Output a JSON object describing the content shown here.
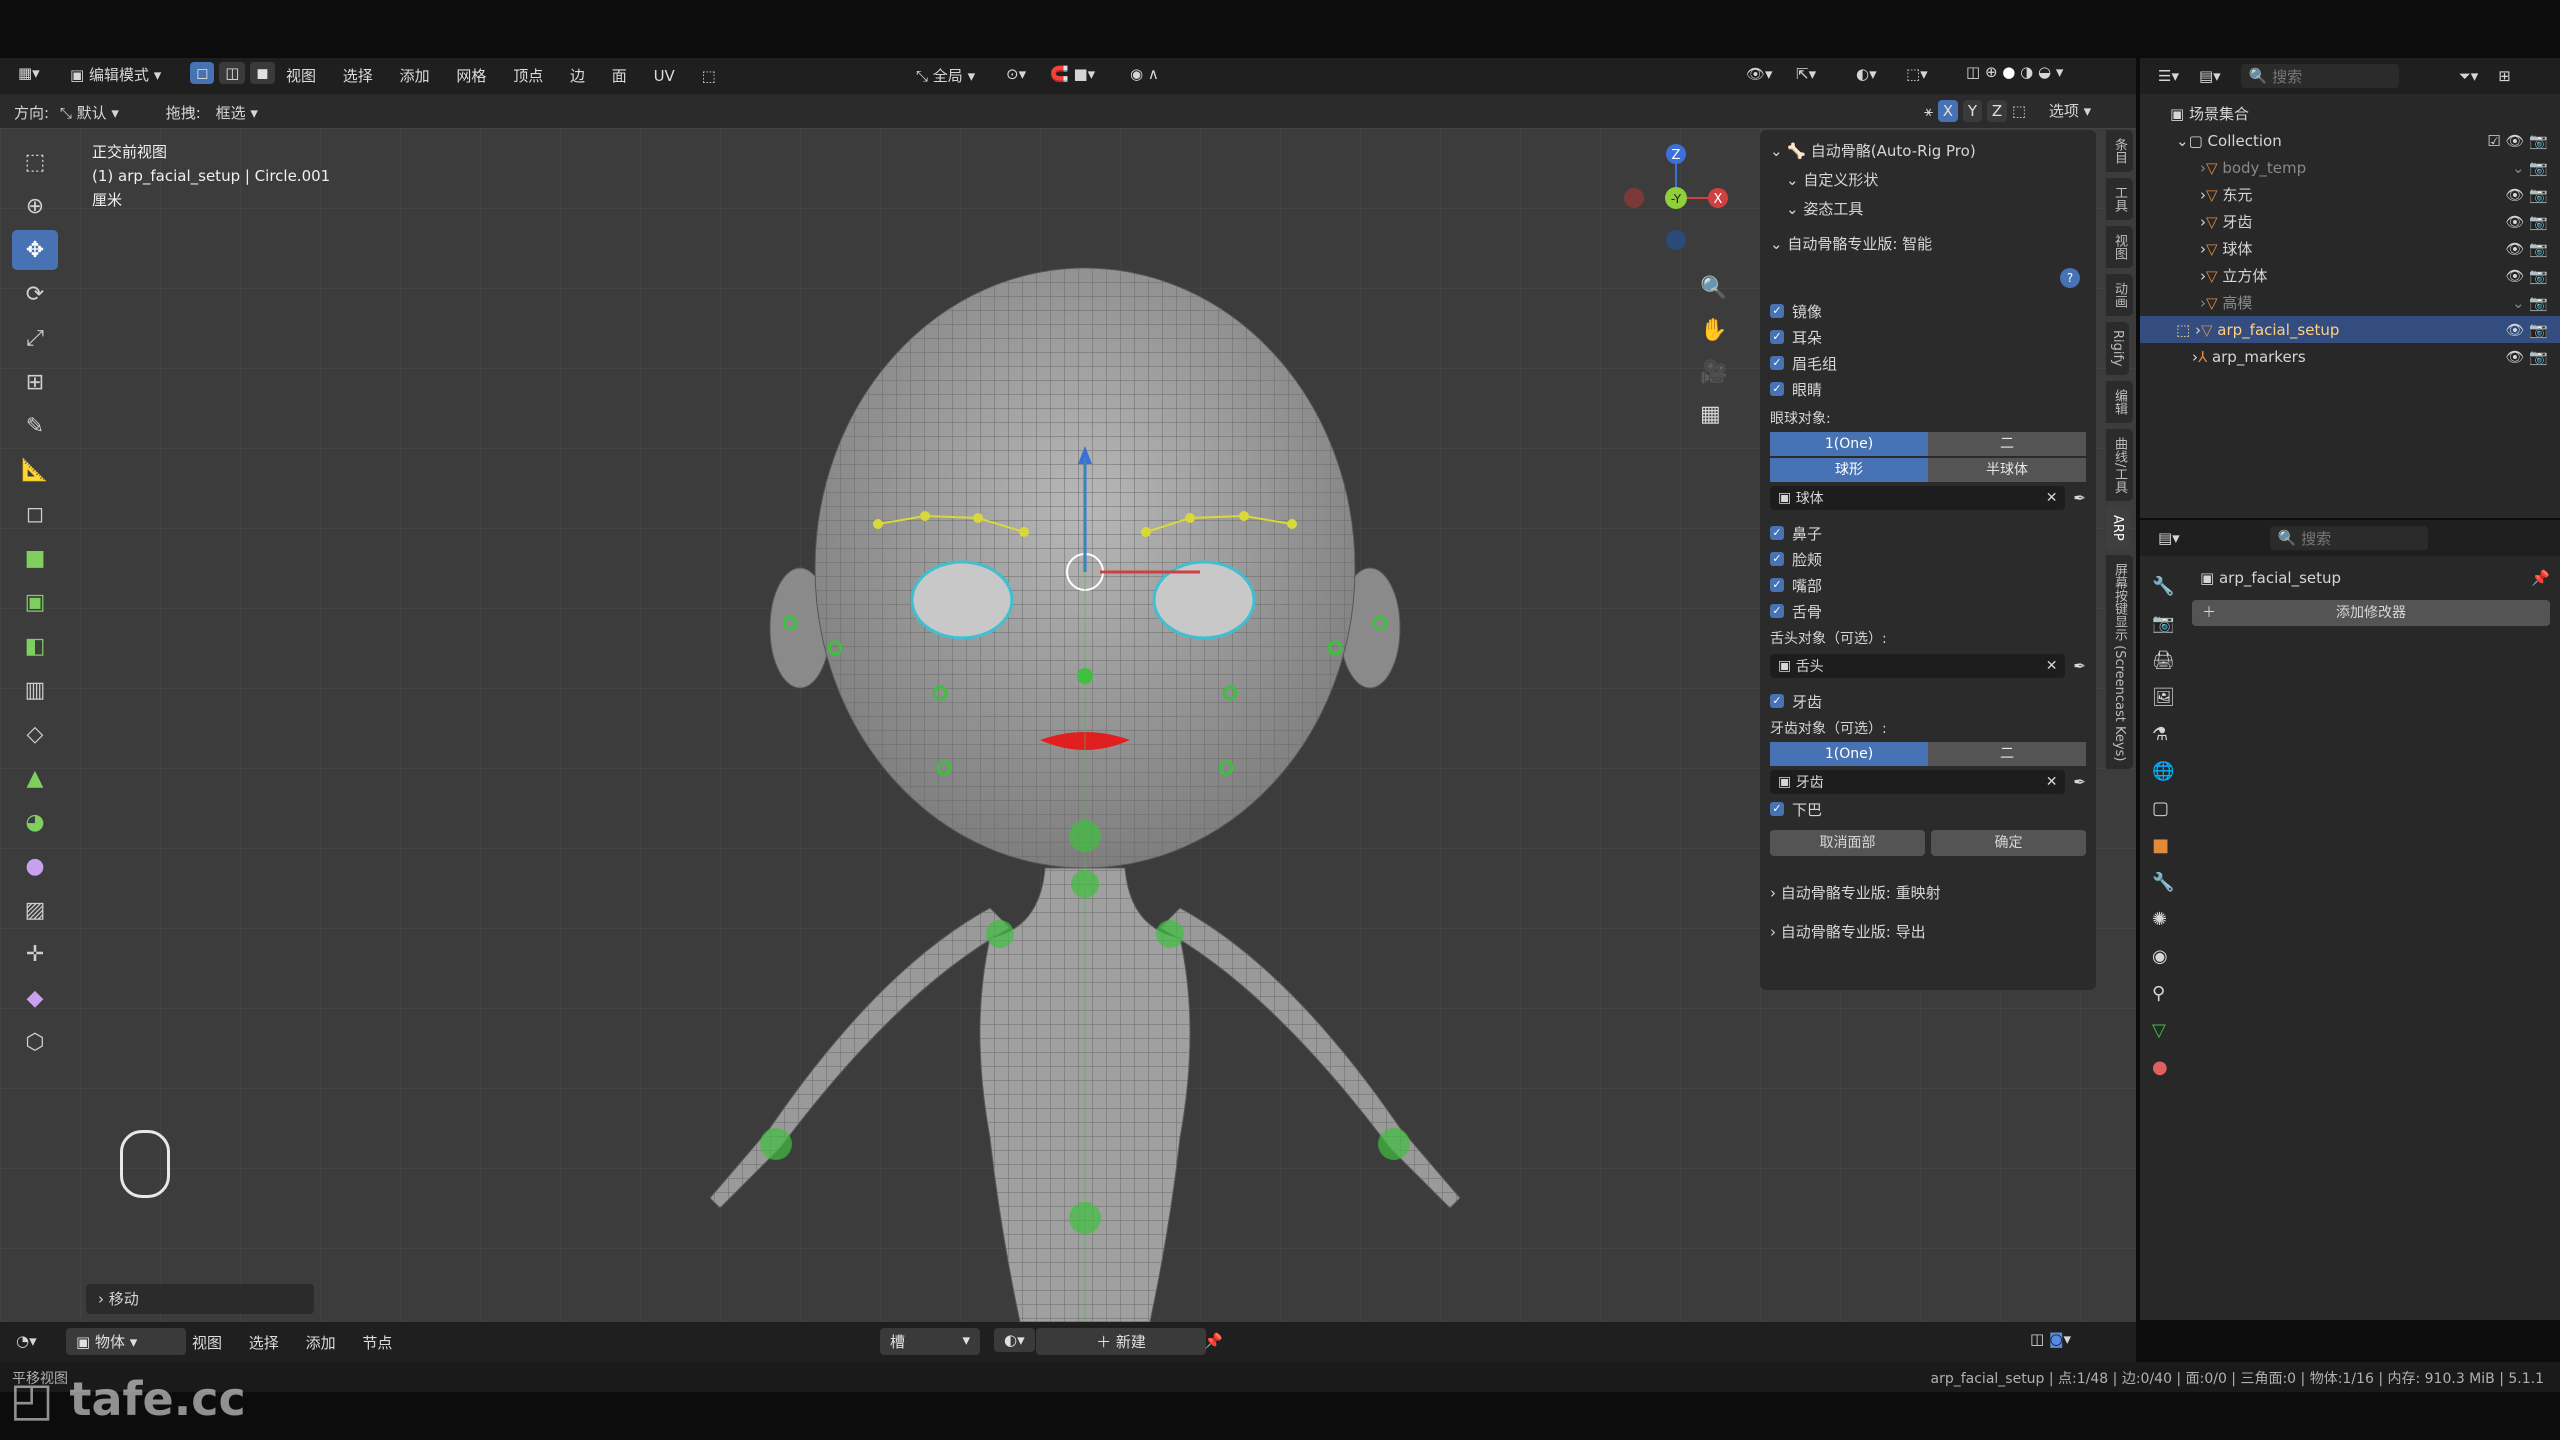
{
  "top_header": {
    "mode": "编辑模式",
    "menus": [
      "视图",
      "选择",
      "添加",
      "网格",
      "顶点",
      "边",
      "面",
      "UV"
    ],
    "transform_orientation": "全局"
  },
  "second_header": {
    "orientation_label": "方向:",
    "orientation_value": "默认",
    "drag_label": "拖拽:",
    "drag_value": "框选",
    "axis_x": "X",
    "axis_y": "Y",
    "axis_z": "Z",
    "options": "选项"
  },
  "viewport_info": {
    "view_name": "正交前视图",
    "object_line": "(1) arp_facial_setup | Circle.001",
    "units": "厘米"
  },
  "gizmo": {
    "z": "Z",
    "y": "-Y",
    "x": "X"
  },
  "npanel": {
    "header_title": "自动骨骼(Auto-Rig Pro)",
    "sub1": "自定义形状",
    "sub2": "姿态工具",
    "smart_title": "自动骨骼专业版: 智能",
    "checks": [
      "镜像",
      "耳朵",
      "眉毛组",
      "眼睛"
    ],
    "eye_object_label": "眼球对象:",
    "eye_seg1": [
      "1(One)",
      "二"
    ],
    "eye_seg2": [
      "球形",
      "半球体"
    ],
    "eye_field": "球体",
    "checks2": [
      "鼻子",
      "脸颊",
      "嘴部",
      "舌骨"
    ],
    "tongue_label": "舌头对象（可选）:",
    "tongue_field": "舌头",
    "teeth_check": "牙齿",
    "teeth_label": "牙齿对象（可选）:",
    "teeth_seg": [
      "1(One)",
      "二"
    ],
    "teeth_field": "牙齿",
    "jaw_check": "下巴",
    "cancel_face": "取消面部",
    "confirm": "确定",
    "remap_title": "自动骨骼专业版: 重映射",
    "export_title": "自动骨骼专业版: 导出"
  },
  "side_tabs": [
    "条目",
    "工具",
    "视图",
    "动画",
    "Rigify",
    "编辑",
    "曲线/工具",
    "ARP",
    "屏幕按键显示 (Screencast Keys)"
  ],
  "outliner": {
    "search_placeholder": "搜索",
    "scene_collection": "场景集合",
    "collection": "Collection",
    "items": [
      "body_temp",
      "东元",
      "牙齿",
      "球体",
      "立方体",
      "高模",
      "arp_facial_setup",
      "arp_markers"
    ]
  },
  "properties": {
    "search_placeholder": "搜索",
    "object_name": "arp_facial_setup",
    "add_modifier": "添加修改器"
  },
  "bottom_header": {
    "mode": "物体",
    "menus": [
      "视图",
      "选择",
      "添加",
      "节点"
    ],
    "slot": "槽",
    "new_button": "新建"
  },
  "last_operator": "移动",
  "status": {
    "left": "平移视图",
    "right": "arp_facial_setup | 点:1/48 | 边:0/40 | 面:0/0 | 三角面:0 | 物体:1/16 | 内存: 910.3 MiB | 5.1.1"
  },
  "watermark": "tafe.cc",
  "colors": {
    "accent": "#4772b3",
    "marker_green": "#3fbf3f",
    "lip_red": "#e02020",
    "guide_yellow": "#d8d83a"
  }
}
